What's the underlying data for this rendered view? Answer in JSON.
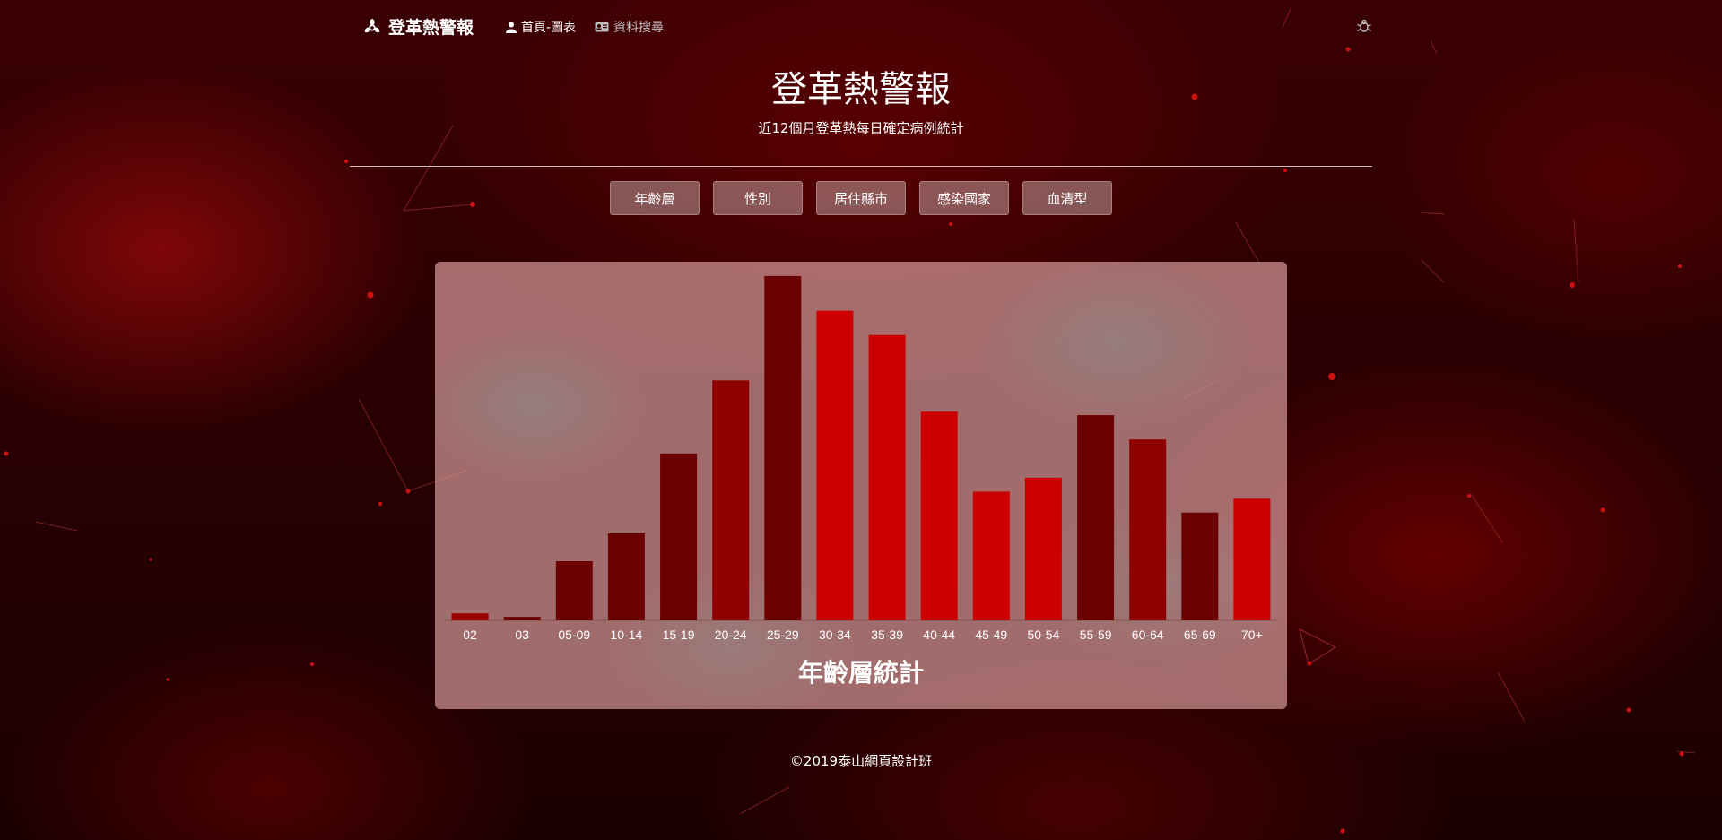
{
  "nav": {
    "brand": "登革熱警報",
    "links": [
      {
        "label": "首頁-圖表",
        "icon": "user-icon",
        "active": true
      },
      {
        "label": "資料搜尋",
        "icon": "id-card-icon",
        "active": false
      }
    ],
    "right_icon": "bug-icon"
  },
  "header": {
    "title": "登革熱警報",
    "subtitle": "近12個月登革熱每日確定病例統計"
  },
  "categories": [
    {
      "label": "年齡層"
    },
    {
      "label": "性別"
    },
    {
      "label": "居住縣市"
    },
    {
      "label": "感染國家"
    },
    {
      "label": "血清型"
    }
  ],
  "chart_data": {
    "type": "bar",
    "title": "年齡層統計",
    "categories": [
      "02",
      "03",
      "05-09",
      "10-14",
      "15-19",
      "20-24",
      "25-29",
      "30-34",
      "35-39",
      "40-44",
      "45-49",
      "50-54",
      "55-59",
      "60-64",
      "65-69",
      "70+"
    ],
    "values": [
      2,
      1,
      17,
      25,
      48,
      69,
      99,
      89,
      82,
      60,
      37,
      41,
      59,
      52,
      31,
      35
    ],
    "colors": [
      "#9a0000",
      "#6a0000",
      "#6a0000",
      "#6a0000",
      "#6a0000",
      "#8e0000",
      "#6a0000",
      "#cc0000",
      "#cc0000",
      "#cc0000",
      "#cc0000",
      "#cc0000",
      "#6a0000",
      "#8e0000",
      "#6a0000",
      "#cc0000"
    ],
    "ylim": [
      0,
      100
    ],
    "grid": false,
    "legend": false
  },
  "footer": {
    "text": "©2019泰山網頁設計班"
  }
}
